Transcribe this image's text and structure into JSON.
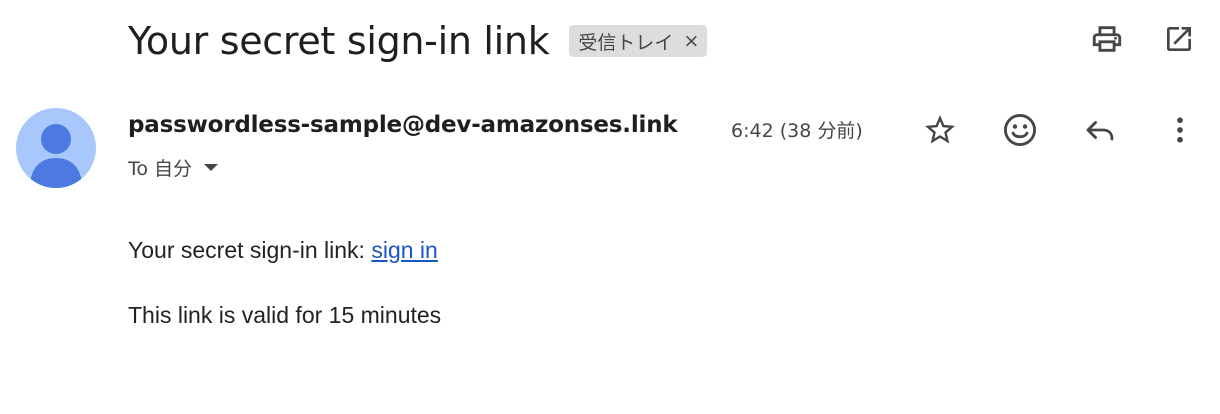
{
  "subject": {
    "title": "Your secret sign-in link",
    "label_chip": "受信トレイ",
    "label_remove": "×"
  },
  "toolbar_icons": {
    "print": "print-icon",
    "open_new_window": "open-in-new-icon"
  },
  "message": {
    "sender": "passwordless-sample@dev-amazonses.link",
    "timestamp": "6:42 (38 分前)",
    "recipient": "To 自分",
    "actions": [
      "star-icon",
      "emoji-icon",
      "reply-icon",
      "more-vert-icon"
    ]
  },
  "body": {
    "line1_prefix": "Your secret sign-in link: ",
    "link_text": "sign in",
    "line2": "This link is valid for 15 minutes"
  },
  "colors": {
    "avatar_bg": "#a8c7fa",
    "avatar_fg": "#4c7ae0",
    "link": "#1a56c2",
    "chip_bg": "#dddddd"
  }
}
